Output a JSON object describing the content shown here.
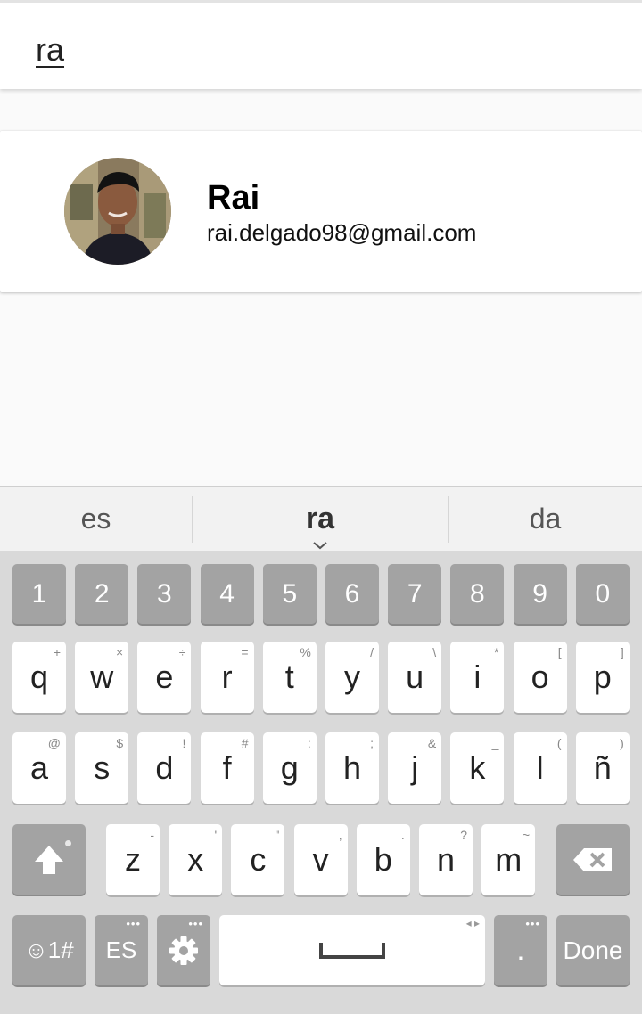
{
  "search": {
    "value": "ra"
  },
  "results": [
    {
      "name": "Rai",
      "email": "rai.delgado98@gmail.com",
      "avatar_icon": "person-photo"
    }
  ],
  "suggestions": {
    "left": "es",
    "middle": "ra",
    "right": "da"
  },
  "keyboard": {
    "numbers": [
      "1",
      "2",
      "3",
      "4",
      "5",
      "6",
      "7",
      "8",
      "9",
      "0"
    ],
    "row1": [
      {
        "k": "q",
        "h": "+"
      },
      {
        "k": "w",
        "h": "×"
      },
      {
        "k": "e",
        "h": "÷"
      },
      {
        "k": "r",
        "h": "="
      },
      {
        "k": "t",
        "h": "%"
      },
      {
        "k": "y",
        "h": "/"
      },
      {
        "k": "u",
        "h": "\\"
      },
      {
        "k": "i",
        "h": "*"
      },
      {
        "k": "o",
        "h": "["
      },
      {
        "k": "p",
        "h": "]"
      }
    ],
    "row2": [
      {
        "k": "a",
        "h": "@"
      },
      {
        "k": "s",
        "h": "$"
      },
      {
        "k": "d",
        "h": "!"
      },
      {
        "k": "f",
        "h": "#"
      },
      {
        "k": "g",
        "h": ":"
      },
      {
        "k": "h",
        "h": ";"
      },
      {
        "k": "j",
        "h": "&"
      },
      {
        "k": "k",
        "h": "_"
      },
      {
        "k": "l",
        "h": "("
      },
      {
        "k": "ñ",
        "h": ")"
      }
    ],
    "row3": [
      {
        "k": "z",
        "h": "-"
      },
      {
        "k": "x",
        "h": "'"
      },
      {
        "k": "c",
        "h": "\""
      },
      {
        "k": "v",
        "h": ","
      },
      {
        "k": "b",
        "h": "."
      },
      {
        "k": "n",
        "h": "?"
      },
      {
        "k": "m",
        "h": "~"
      }
    ],
    "symbols_label": "☺1#",
    "language_label": "ES",
    "period_label": ".",
    "done_label": "Done",
    "space_hint": "◂ ▸",
    "dots": "•••"
  },
  "colors": {
    "key_white": "#ffffff",
    "key_gray": "#a3a3a3",
    "keyboard_bg": "#d9d9d9"
  }
}
